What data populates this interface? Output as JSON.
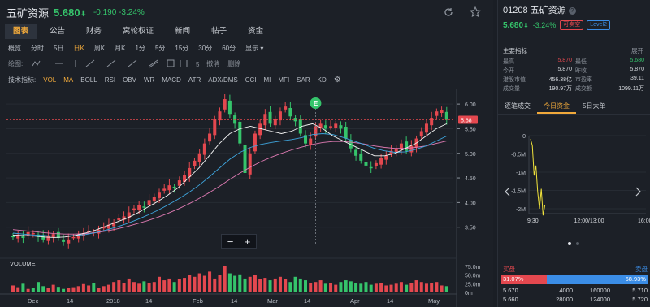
{
  "header": {
    "name": "五矿资源",
    "price": "5.680",
    "arrow": "⬇",
    "change": "-0.190 -3.24%"
  },
  "tabs": [
    "图表",
    "公告",
    "财务",
    "窝轮权证",
    "新闻",
    "帖子",
    "资金"
  ],
  "periods": [
    "概览",
    "分时",
    "5日",
    "日K",
    "周K",
    "月K",
    "1分",
    "5分",
    "15分",
    "30分",
    "60分",
    "显示 ▾"
  ],
  "draw_label": "绘图:",
  "draw_actions": [
    "撤消",
    "删除"
  ],
  "indicators_label": "技术指标:",
  "indicators": [
    "VOL",
    "MA",
    "BOLL",
    "RSI",
    "OBV",
    "WR",
    "MACD",
    "ATR",
    "ADX/DMS",
    "CCI",
    "MI",
    "MFI",
    "SAR",
    "KD"
  ],
  "chart_data": {
    "type": "candlestick",
    "price_axis": {
      "ticks": [
        "6.00",
        "5.50",
        "5.00",
        "4.50",
        "4.00",
        "3.50"
      ],
      "range": [
        3.0,
        6.2
      ]
    },
    "current_price_label": "5.68",
    "x_ticks": [
      "Dec",
      "14",
      "2018",
      "14",
      "Feb",
      "14",
      "Mar",
      "14",
      "Apr",
      "14",
      "May"
    ],
    "volume_label": "VOLUME",
    "volume_ticks": [
      "75.0m",
      "50.0m",
      "25.0m",
      "0m"
    ],
    "event_marker": "E",
    "closes": [
      3.3,
      3.35,
      3.28,
      3.4,
      3.38,
      3.3,
      3.25,
      3.32,
      3.36,
      3.28,
      3.2,
      3.25,
      3.3,
      3.35,
      3.38,
      3.42,
      3.4,
      3.45,
      3.5,
      3.55,
      3.6,
      3.68,
      3.72,
      3.8,
      3.88,
      3.95,
      3.9,
      4.05,
      4.12,
      4.2,
      4.28,
      4.35,
      4.3,
      4.45,
      4.55,
      4.7,
      4.85,
      5.0,
      5.2,
      5.4,
      5.7,
      5.85,
      6.1,
      5.8,
      5.6,
      5.2,
      4.6,
      5.0,
      5.4,
      5.6,
      5.8,
      5.6,
      5.7,
      5.85,
      5.95,
      5.75,
      5.65,
      5.4,
      5.2,
      5.3,
      5.55,
      5.6,
      5.5,
      5.55,
      5.6,
      5.5,
      5.3,
      5.1,
      4.95,
      4.85,
      4.75,
      4.7,
      4.8,
      4.9,
      4.95,
      5.05,
      5.1,
      5.2,
      5.05,
      5.15,
      5.3,
      5.45,
      5.6,
      5.72,
      5.85,
      5.87,
      5.68
    ],
    "ma_short": [
      3.34,
      3.33,
      3.32,
      3.3,
      3.29,
      3.3,
      3.33,
      3.38,
      3.44,
      3.52,
      3.6,
      3.68,
      3.78,
      3.9,
      4.02,
      4.15,
      4.3,
      4.5,
      4.7,
      4.95,
      5.2,
      5.4,
      5.5,
      5.55,
      5.5,
      5.45,
      5.4,
      5.45,
      5.55,
      5.6,
      5.5,
      5.35,
      5.25,
      5.15,
      5.05,
      4.95,
      4.95,
      5.0,
      5.1,
      5.2,
      5.35,
      5.5,
      5.6
    ],
    "ma_mid": [
      3.38,
      3.36,
      3.34,
      3.33,
      3.32,
      3.32,
      3.33,
      3.35,
      3.39,
      3.44,
      3.5,
      3.57,
      3.65,
      3.74,
      3.84,
      3.95,
      4.07,
      4.2,
      4.35,
      4.52,
      4.7,
      4.88,
      5.02,
      5.12,
      5.18,
      5.22,
      5.25,
      5.28,
      5.32,
      5.38,
      5.4,
      5.38,
      5.32,
      5.25,
      5.18,
      5.1,
      5.05,
      5.02,
      5.03,
      5.08,
      5.15,
      5.25,
      5.35
    ],
    "ma_long": [
      3.45,
      3.43,
      3.41,
      3.39,
      3.37,
      3.36,
      3.36,
      3.37,
      3.39,
      3.42,
      3.46,
      3.51,
      3.57,
      3.63,
      3.7,
      3.78,
      3.87,
      3.97,
      4.08,
      4.2,
      4.33,
      4.47,
      4.6,
      4.72,
      4.83,
      4.92,
      5.0,
      5.07,
      5.13,
      5.18,
      5.22,
      5.24,
      5.24,
      5.22,
      5.19,
      5.15,
      5.12,
      5.1,
      5.1,
      5.12,
      5.15,
      5.2,
      5.25
    ],
    "volumes": [
      20,
      15,
      25,
      10,
      12,
      30,
      18,
      14,
      22,
      16,
      10,
      12,
      15,
      18,
      24,
      20,
      26,
      14,
      18,
      22,
      30,
      35,
      28,
      40,
      30,
      25,
      32,
      28,
      30,
      45,
      35,
      40,
      30,
      38,
      42,
      50,
      45,
      55,
      48,
      60,
      40,
      50,
      75,
      55,
      48,
      52,
      40,
      45,
      50,
      38,
      42,
      35,
      40,
      45,
      38,
      30,
      45,
      40,
      35,
      28,
      30,
      35,
      25,
      28,
      22,
      30,
      35,
      32,
      28,
      25,
      30,
      22,
      25,
      28,
      20,
      22,
      25,
      30,
      22,
      28,
      35,
      30,
      25,
      28,
      30,
      20,
      18
    ]
  },
  "side": {
    "code_name": "01208 五矿资源",
    "help": "?",
    "price": "5.680",
    "arrow": "⬇",
    "change": "-3.24%",
    "badge_short": "可卖空",
    "badge_level": "Level2",
    "key_label": "主要指标",
    "expand": "展开",
    "kv": [
      [
        [
          "最高",
          "5.870",
          "red"
        ],
        [
          "最低",
          "5.680",
          "green"
        ]
      ],
      [
        [
          "今开",
          "5.870",
          ""
        ],
        [
          "昨收",
          "5.870",
          ""
        ]
      ],
      [
        [
          "港股市值",
          "456.38亿",
          ""
        ],
        [
          "市盈率",
          "39.11",
          ""
        ]
      ],
      [
        [
          "成交量",
          "190.97万",
          ""
        ],
        [
          "成交额",
          "1099.11万",
          ""
        ]
      ]
    ],
    "rtabs": [
      "逐笔成交",
      "今日资金",
      "5日大单"
    ],
    "mini_chart": {
      "y_ticks": [
        "0",
        "-0.5M",
        "-1M",
        "-1.5M",
        "-2M"
      ],
      "x_ticks": [
        "9:30",
        "12:00/13:00",
        "16:00"
      ],
      "values": [
        -0.1,
        -0.3,
        -1.2,
        -0.9,
        -1.7,
        -2.2,
        -1.6,
        -2.4,
        -2.1
      ]
    },
    "buy_label": "买盘",
    "sell_label": "卖盘",
    "buy_pct": "31.07%",
    "sell_pct": "68.93%",
    "book": [
      [
        "5.670",
        "4000",
        "160000",
        "5.710"
      ],
      [
        "5.660",
        "28000",
        "124000",
        "5.720"
      ]
    ]
  },
  "colors": {
    "up": "#e4484f",
    "down": "#35c46b",
    "accent": "#f0a93b",
    "ma1": "#f5f5f5",
    "ma2": "#e07bb4",
    "ma3": "#3fa7e0",
    "buy_bar": "#e4484f",
    "sell_bar": "#3b8de6"
  }
}
